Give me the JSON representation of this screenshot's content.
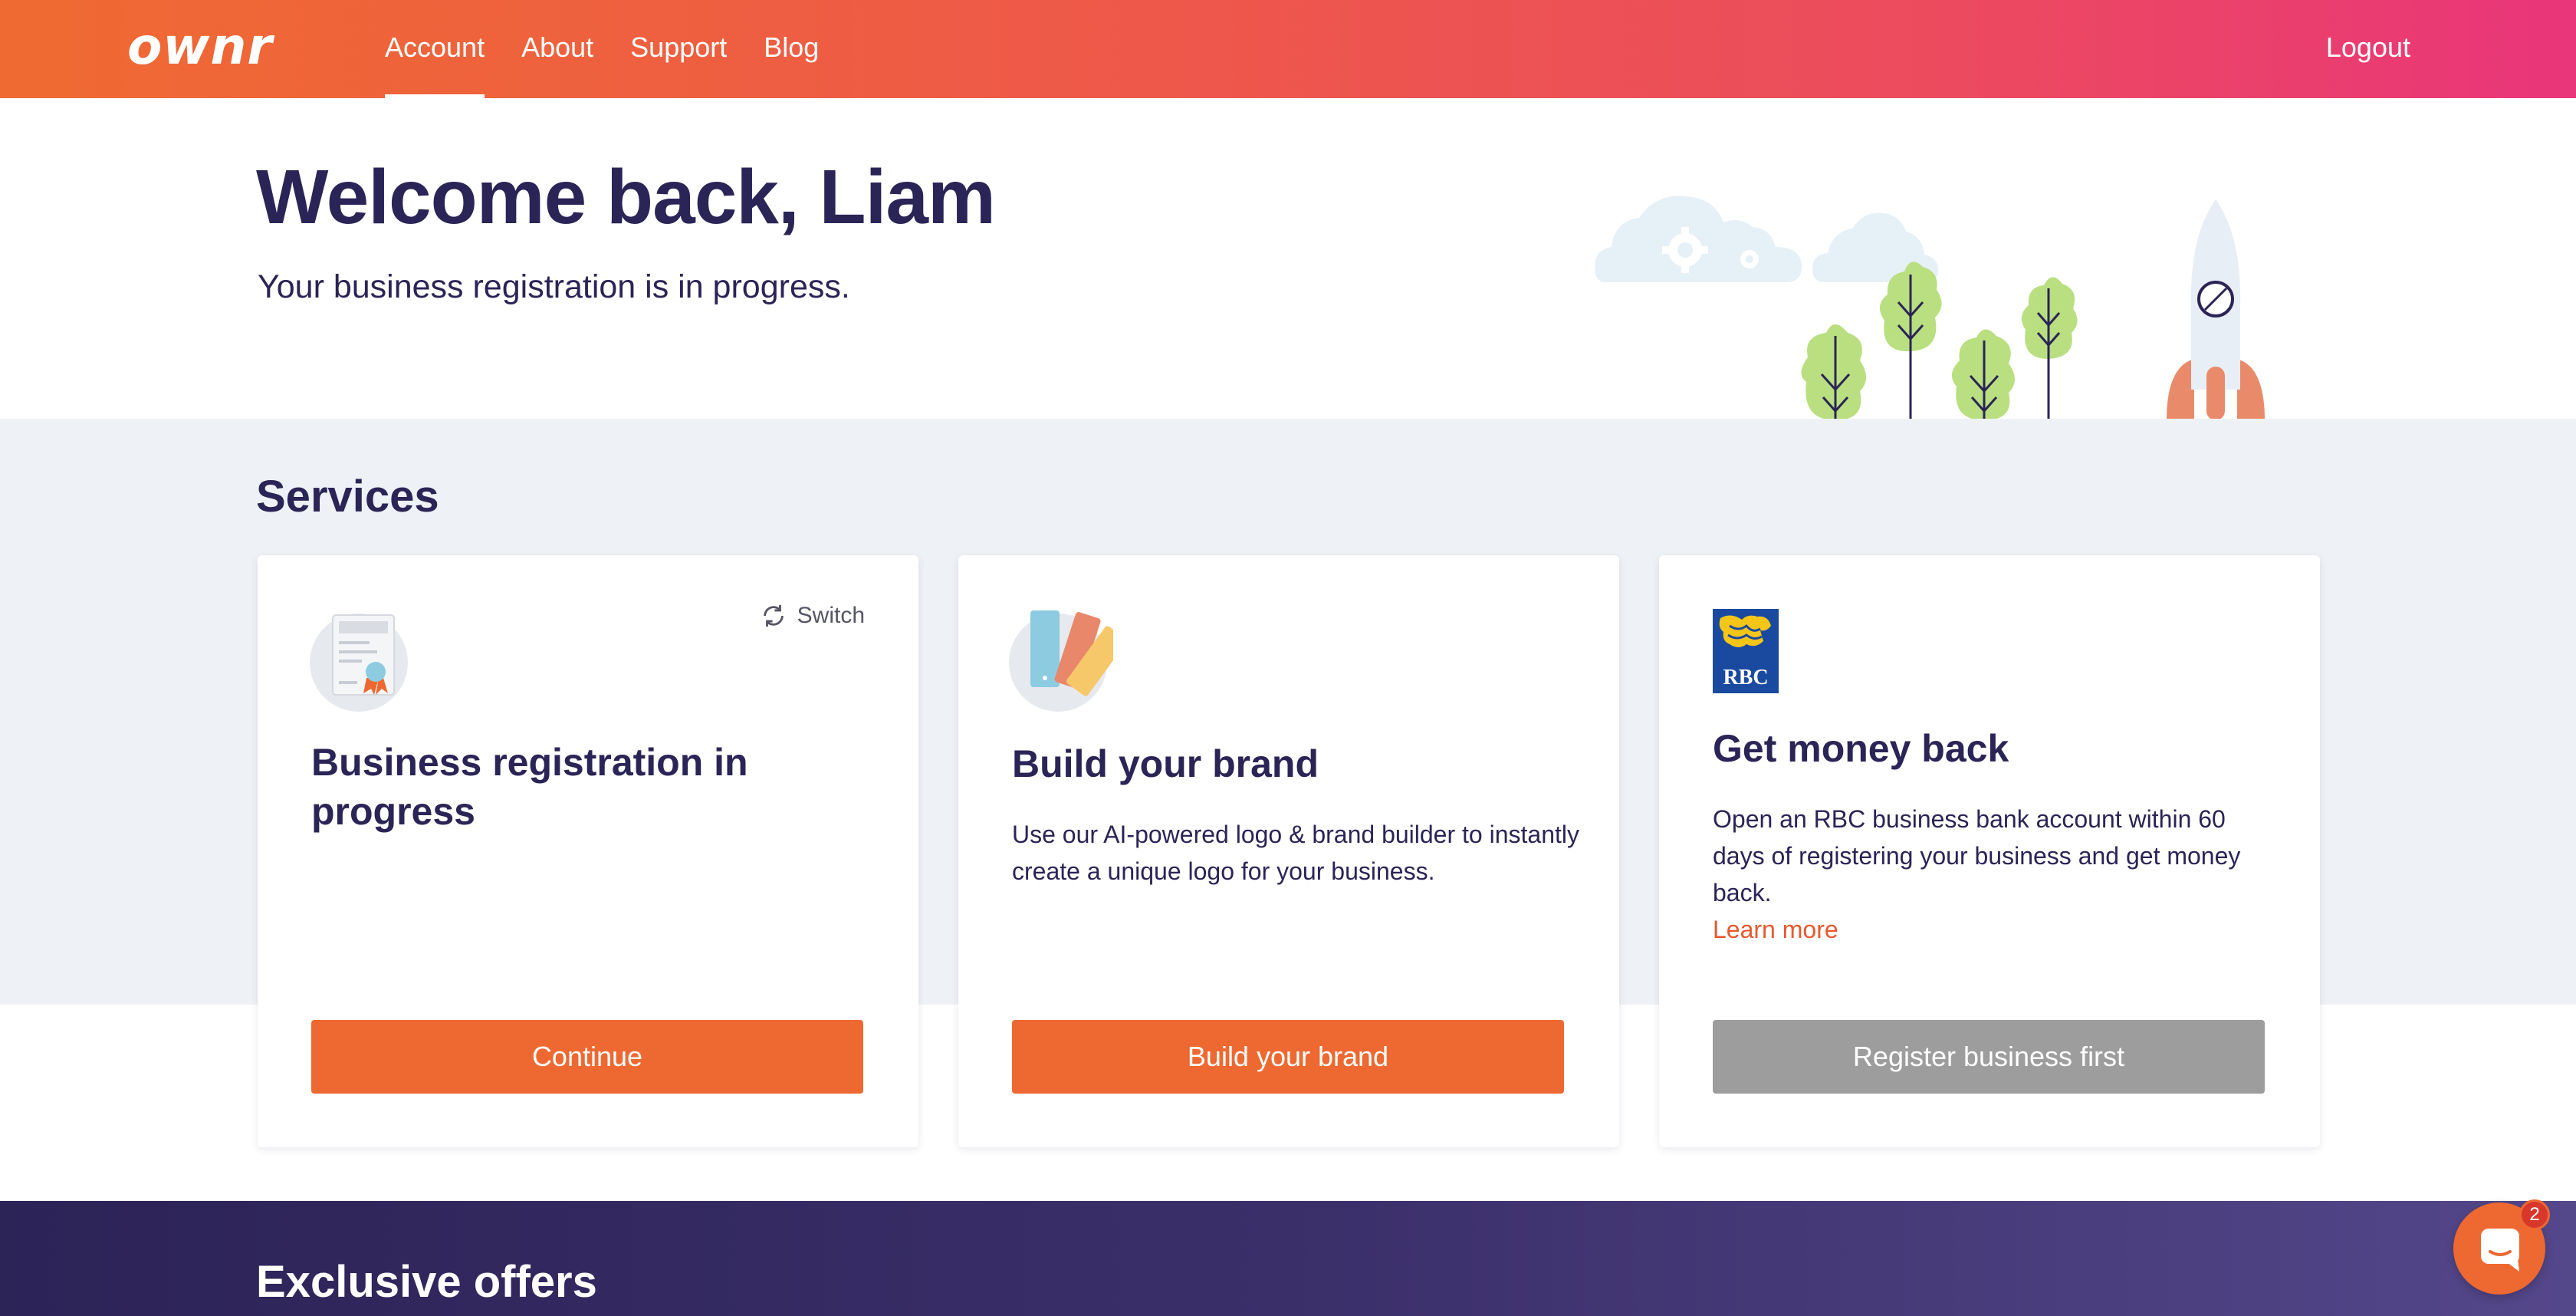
{
  "nav": {
    "logo": "ownr",
    "links": [
      "Account",
      "About",
      "Support",
      "Blog"
    ],
    "active": "Account",
    "logout": "Logout"
  },
  "hero": {
    "title": "Welcome back, Liam",
    "subtitle": "Your business registration is in progress."
  },
  "services": {
    "title": "Services",
    "cards": [
      {
        "icon": "certificate-icon",
        "title": "Business registration in progress",
        "switch_label": "Switch",
        "button": "Continue"
      },
      {
        "icon": "color-swatches-icon",
        "title": "Build your brand",
        "description": "Use our AI-powered logo & brand builder to instantly create a unique logo for your business.",
        "button": "Build your brand"
      },
      {
        "icon": "rbc-logo",
        "logo_text": "RBC",
        "title": "Get money back",
        "description": "Open an RBC business bank account within 60 days of registering your business and get money back.",
        "link": "Learn more",
        "button": "Register business first"
      }
    ]
  },
  "offers": {
    "title": "Exclusive offers"
  },
  "chat": {
    "badge_count": "2"
  },
  "colors": {
    "nav_gradient_start": "#ef6a32",
    "nav_gradient_end": "#e9357a",
    "primary_button": "#ed6931",
    "disabled_button": "#9d9d9d",
    "heading": "#2b2456",
    "services_background": "#eef1f5",
    "offers_background": "#2c2357"
  }
}
